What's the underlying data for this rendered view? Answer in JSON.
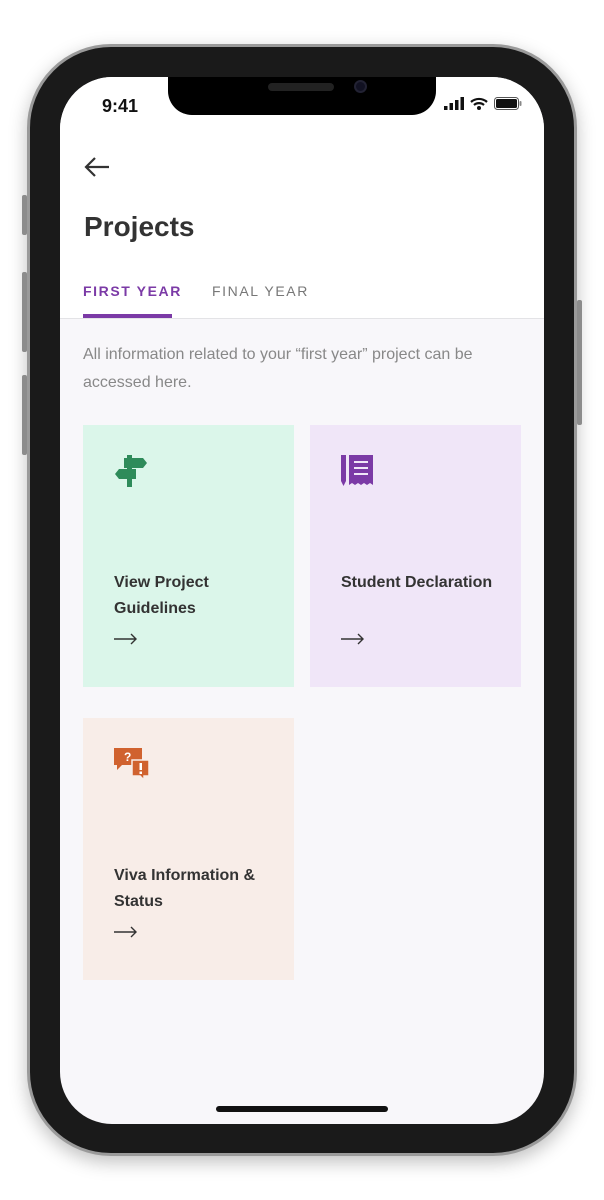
{
  "status_bar": {
    "time": "9:41"
  },
  "header": {
    "title": "Projects"
  },
  "tabs": [
    {
      "label": "FIRST YEAR",
      "active": true
    },
    {
      "label": "FINAL YEAR",
      "active": false
    }
  ],
  "description": "All information related to your “first year” project can be accessed here.",
  "cards": [
    {
      "label": "View Project Guidelines",
      "icon": "signpost-icon",
      "bg": "#dbf6ea",
      "icon_color": "#2e8b5a"
    },
    {
      "label": "Student Declaration",
      "icon": "receipt-pencil-icon",
      "bg": "#f0e6f8",
      "icon_color": "#7b3aa6"
    },
    {
      "label": "Viva Information & Status",
      "icon": "question-exclamation-chat-icon",
      "bg": "#f8ede8",
      "icon_color": "#d0622f"
    }
  ],
  "accent": "#7b3aa6"
}
